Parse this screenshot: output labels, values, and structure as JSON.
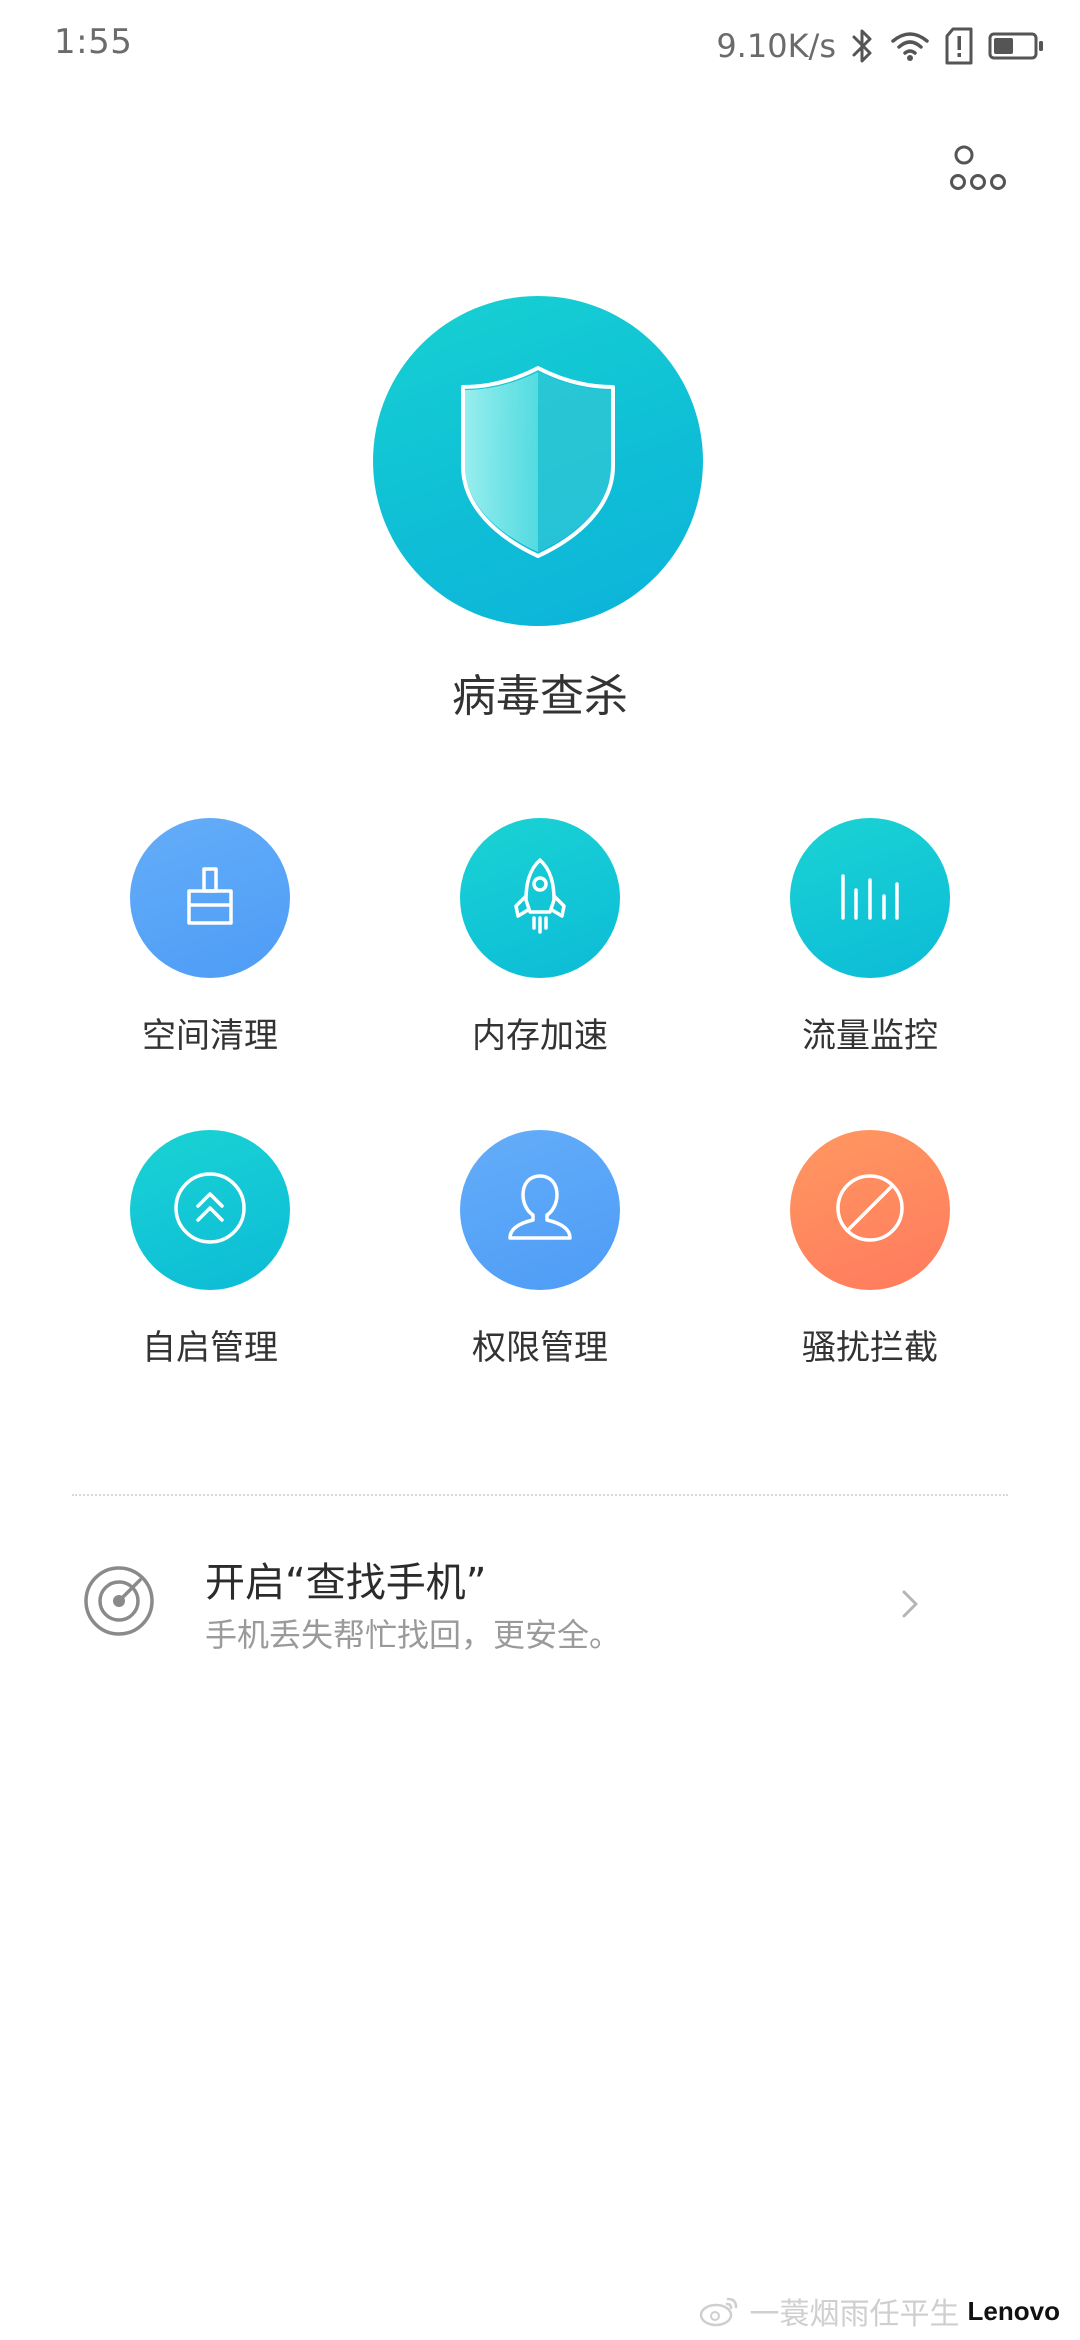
{
  "status_bar": {
    "time": "1:55",
    "net_speed": "9.10K/s",
    "icons": [
      "bluetooth-icon",
      "wifi-icon",
      "sim-alert-icon",
      "battery-icon"
    ],
    "battery_level": 0.5
  },
  "header": {
    "menu_icon": "more-circles-icon"
  },
  "hero": {
    "label": "病毒查杀",
    "icon": "shield-icon"
  },
  "tools": [
    {
      "label": "空间清理",
      "icon": "brush-icon",
      "color": "#5aa5f8"
    },
    {
      "label": "内存加速",
      "icon": "rocket-icon",
      "color": "#12c4d5"
    },
    {
      "label": "流量监控",
      "icon": "bars-icon",
      "color": "#12c4d5"
    },
    {
      "label": "自启管理",
      "icon": "double-chevron-up-icon",
      "color": "#12c4d5"
    },
    {
      "label": "权限管理",
      "icon": "user-icon",
      "color": "#5aa5f8"
    },
    {
      "label": "骚扰拦截",
      "icon": "block-icon",
      "color": "#ff8a5e"
    }
  ],
  "find_phone": {
    "title": "开启“查找手机”",
    "subtitle": "手机丢失帮忙找回，更安全。",
    "icon": "radar-icon"
  },
  "watermark": {
    "text": "一蓑烟雨任平生",
    "brand": "Lenovo"
  }
}
